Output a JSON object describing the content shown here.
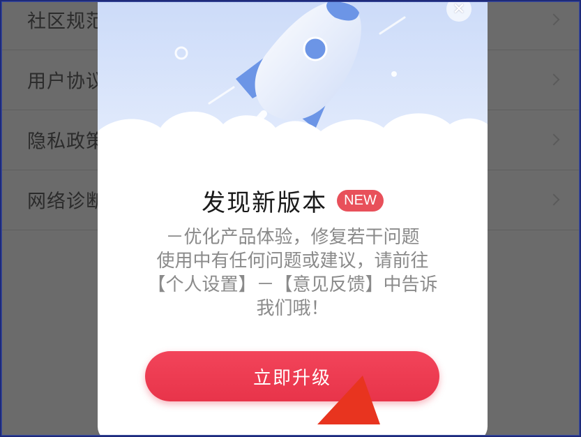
{
  "settings": {
    "items": [
      {
        "label": "社区规范"
      },
      {
        "label": "用户协议"
      },
      {
        "label": "隐私政策"
      },
      {
        "label": "网络诊断"
      }
    ]
  },
  "dialog": {
    "close_icon": "close-icon",
    "title": "发现新版本",
    "badge": "NEW",
    "description_lines": [
      "－优化产品体验，修复若干问题",
      "使用中有任何问题或建议，请前往",
      "【个人设置】－【意见反馈】中告诉",
      "我们哦！"
    ],
    "upgrade_label": "立即升级"
  },
  "colors": {
    "accent_red": "#e8344a",
    "badge_red": "#e8505a",
    "hero_blue": "#dbe6fb",
    "overlay_gray": "#6b6b6b"
  }
}
